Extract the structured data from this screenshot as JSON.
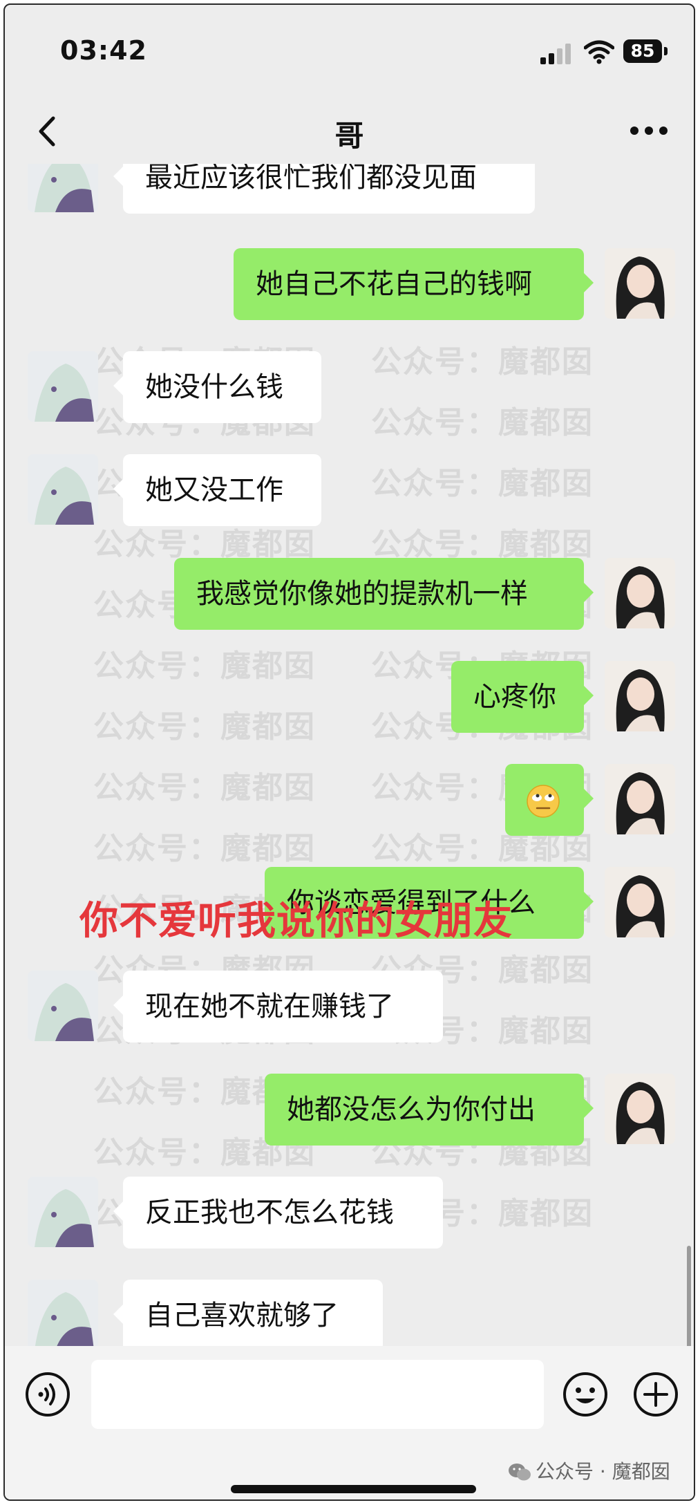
{
  "status_bar": {
    "time": "03:42",
    "battery": "85"
  },
  "nav": {
    "title": "哥"
  },
  "messages": [
    {
      "side": "in",
      "text": "最近应该很忙我们都没见面"
    },
    {
      "side": "out",
      "text": "她自己不花自己的钱啊"
    },
    {
      "side": "in",
      "text": "她没什么钱"
    },
    {
      "side": "in",
      "text": "她又没工作"
    },
    {
      "side": "out",
      "text": "我感觉你像她的提款机一样"
    },
    {
      "side": "out",
      "text": "心疼你"
    },
    {
      "side": "out",
      "text": "",
      "emoji": "eye-roll-emoji"
    },
    {
      "side": "out",
      "text": "你谈恋爱得到了什么"
    },
    {
      "side": "in",
      "text": "现在她不就在赚钱了"
    },
    {
      "side": "out",
      "text": "她都没怎么为你付出"
    },
    {
      "side": "in",
      "text": "反正我也不怎么花钱"
    },
    {
      "side": "in",
      "text": "自己喜欢就够了"
    }
  ],
  "overlay_caption": "你不爱听我说你的女朋友",
  "watermark": {
    "left": "公众号：魔都囡",
    "right": "公众号：魔都囡"
  },
  "input_bar": {
    "placeholder": "",
    "icons": [
      "voice-icon",
      "emoji-icon",
      "plus-icon"
    ]
  },
  "source_tag": "公众号 · 魔都囡",
  "colors": {
    "background": "#ededed",
    "outgoing_bubble": "#95ec69",
    "incoming_bubble": "#ffffff",
    "caption": "#e5373c"
  }
}
